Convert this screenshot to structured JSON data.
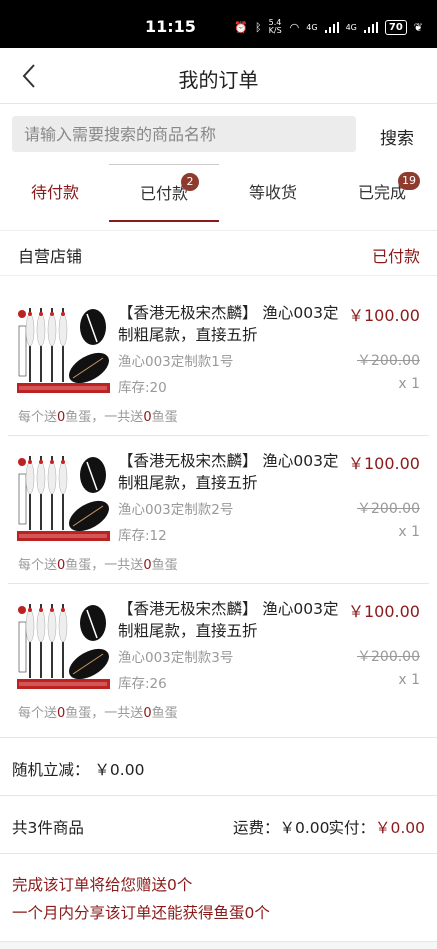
{
  "status_bar": {
    "time": "11:15",
    "network_speed": "5.4 K/S",
    "signal_1": "4G",
    "signal_2": "4G",
    "battery": "70"
  },
  "navbar": {
    "title": "我的订单",
    "back_icon": "chevron-left-icon"
  },
  "search": {
    "placeholder": "请输入需要搜索的商品名称",
    "button_label": "搜索"
  },
  "tabs": [
    {
      "label": "待付款",
      "badge": "",
      "active": false
    },
    {
      "label": "已付款",
      "badge": "2",
      "active": true
    },
    {
      "label": "等收货",
      "badge": "",
      "active": false
    },
    {
      "label": "已完成",
      "badge": "19",
      "active": false
    }
  ],
  "order": {
    "shop_name": "自营店铺",
    "status": "已付款",
    "items": [
      {
        "title": "【香港无极宋杰麟】 渔心003定制粗尾款，直接五折",
        "price": "￥100.00",
        "spec": "渔心003定制款1号",
        "original_price": "￥200.00",
        "stock": "库存:20",
        "qty": "x 1",
        "gift_prefix": "每个送",
        "gift_each": "0",
        "gift_middle": "鱼蛋，一共送",
        "gift_total": "0",
        "gift_suffix": "鱼蛋"
      },
      {
        "title": "【香港无极宋杰麟】 渔心003定制粗尾款，直接五折",
        "price": "￥100.00",
        "spec": "渔心003定制款2号",
        "original_price": "￥200.00",
        "stock": "库存:12",
        "qty": "x 1",
        "gift_prefix": "每个送",
        "gift_each": "0",
        "gift_middle": "鱼蛋，一共送",
        "gift_total": "0",
        "gift_suffix": "鱼蛋"
      },
      {
        "title": "【香港无极宋杰麟】 渔心003定制粗尾款，直接五折",
        "price": "￥100.00",
        "spec": "渔心003定制款3号",
        "original_price": "￥200.00",
        "stock": "库存:26",
        "qty": "x 1",
        "gift_prefix": "每个送",
        "gift_each": "0",
        "gift_middle": "鱼蛋，一共送",
        "gift_total": "0",
        "gift_suffix": "鱼蛋"
      }
    ],
    "discount": "随机立减：  ￥0.00",
    "count": "共3件商品",
    "shipping": "运费：￥0.00",
    "paid_label": "实付：",
    "paid_amount": "￥0.00",
    "promo_line1": "完成该订单将给您赠送0个",
    "promo_line2": "一个月内分享该订单还能获得鱼蛋0个"
  },
  "colors": {
    "accent": "#8b1a1a",
    "badge": "#8e3b2e",
    "muted": "#999999"
  }
}
